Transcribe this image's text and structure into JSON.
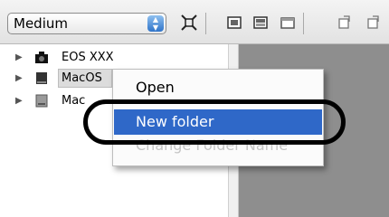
{
  "toolbar": {
    "size_select": {
      "value": "Medium"
    },
    "buttons": [
      "fit-window-icon",
      "display-mode-1-icon",
      "display-mode-2-icon",
      "window-icon",
      "rotate-left-icon",
      "rotate-right-icon"
    ]
  },
  "tree": {
    "items": [
      {
        "label": "EOS XXX",
        "icon": "camera-icon"
      },
      {
        "label": "MacOS",
        "icon": "disk-drive-icon"
      },
      {
        "label": "Mac",
        "icon": "disk-drive-icon"
      }
    ]
  },
  "context_menu": {
    "items": [
      {
        "label": "Open"
      },
      {
        "label": "New folder"
      },
      {
        "label": "Change Folder Name"
      }
    ],
    "highlight_color": "#2f68c8"
  }
}
